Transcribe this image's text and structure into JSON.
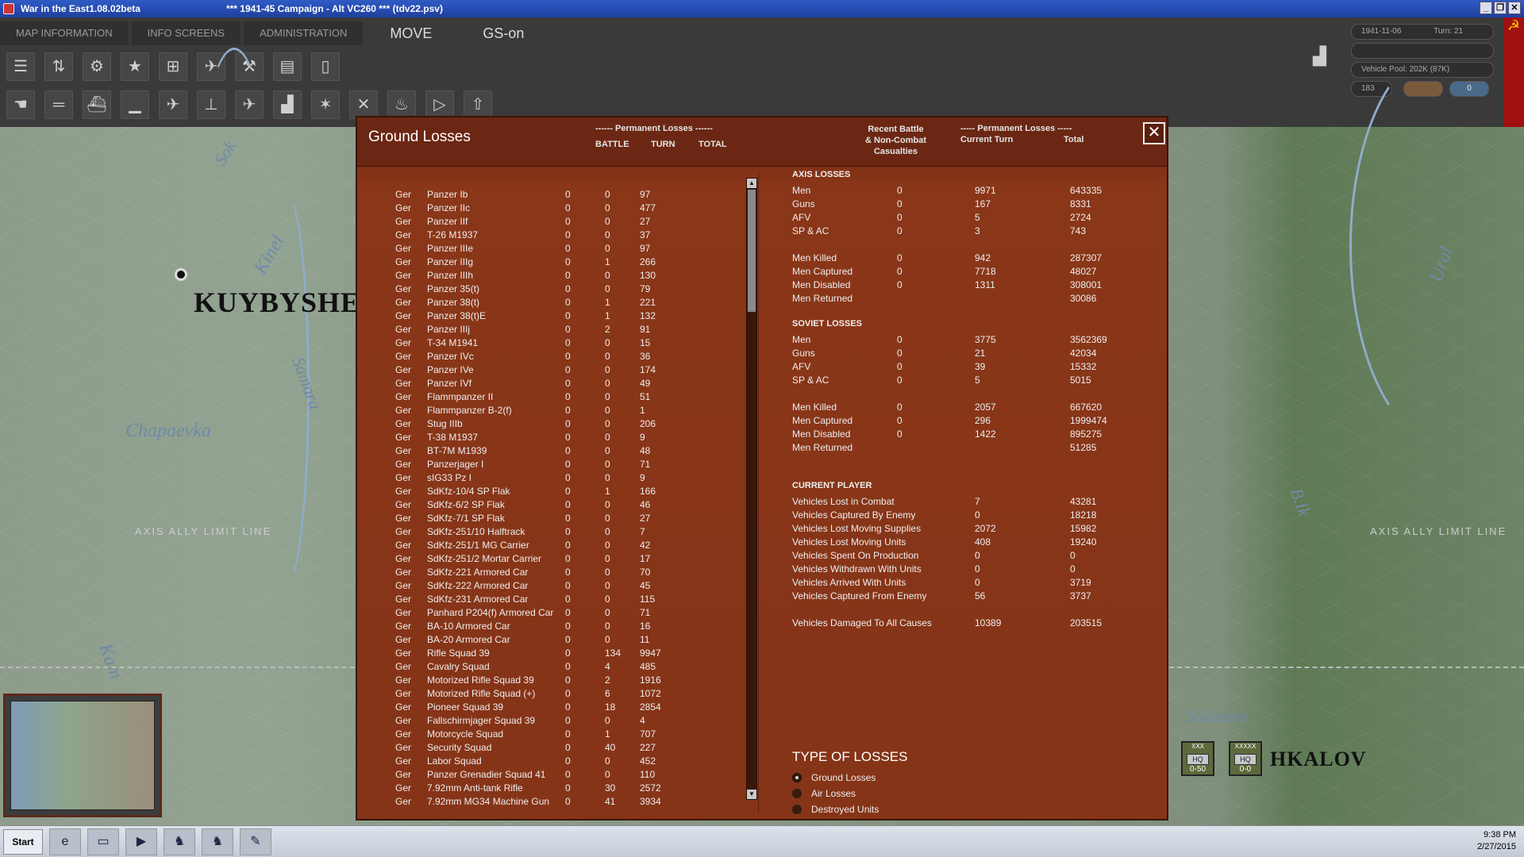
{
  "window": {
    "title": "War in the East1.08.02beta",
    "campaign": "***  1941-45 Campaign - Alt VC260  ***   (tdv22.psv)"
  },
  "menu": {
    "map_info": "MAP INFORMATION",
    "info_screens": "INFO SCREENS",
    "administration": "ADMINISTRATION",
    "mode": "MOVE",
    "gs": "GS-on"
  },
  "status": {
    "date": "1941-11-06",
    "turn": "Turn: 21",
    "vehicle_pool": "Vehicle Pool: 202K (87K)",
    "value": "183"
  },
  "map": {
    "city1": "KUYBYSHEV",
    "city2": "HKALOV",
    "rivers": [
      "Sok",
      "Kinel",
      "Samara",
      "Chapaevka",
      "Kam",
      "Ural",
      "B.Ik",
      "Sakmara"
    ],
    "limit_label": "AXIS ALLY LIMIT LINE",
    "unit1_top": "XXX",
    "unit1_bottom": "0-50",
    "unit2_top": "XXXXX",
    "unit2_bottom": "0-0",
    "hq": "HQ"
  },
  "dialog": {
    "title": "Ground Losses",
    "left_header": {
      "group": "------ Permanent Losses ------",
      "battle": "BATTLE",
      "turn": "TURN",
      "total": "TOTAL"
    },
    "right_header": {
      "recent1": "Recent Battle",
      "recent2": "& Non-Combat",
      "recent3": "Casualties",
      "group": "----- Permanent Losses -----",
      "current": "Current Turn",
      "total": "Total"
    },
    "rows": [
      [
        "Ger",
        "Panzer Ib",
        "0",
        "0",
        "97"
      ],
      [
        "Ger",
        "Panzer IIc",
        "0",
        "0",
        "477"
      ],
      [
        "Ger",
        "Panzer IIf",
        "0",
        "0",
        "27"
      ],
      [
        "Ger",
        "T-26 M1937",
        "0",
        "0",
        "37"
      ],
      [
        "Ger",
        "Panzer IIIe",
        "0",
        "0",
        "97"
      ],
      [
        "Ger",
        "Panzer IIIg",
        "0",
        "1",
        "266"
      ],
      [
        "Ger",
        "Panzer IIIh",
        "0",
        "0",
        "130"
      ],
      [
        "Ger",
        "Panzer 35(t)",
        "0",
        "0",
        "79"
      ],
      [
        "Ger",
        "Panzer 38(t)",
        "0",
        "1",
        "221"
      ],
      [
        "Ger",
        "Panzer 38(t)E",
        "0",
        "1",
        "132"
      ],
      [
        "Ger",
        "Panzer IIIj",
        "0",
        "2",
        "91"
      ],
      [
        "Ger",
        "T-34 M1941",
        "0",
        "0",
        "15"
      ],
      [
        "Ger",
        "Panzer IVc",
        "0",
        "0",
        "36"
      ],
      [
        "Ger",
        "Panzer IVe",
        "0",
        "0",
        "174"
      ],
      [
        "Ger",
        "Panzer IVf",
        "0",
        "0",
        "49"
      ],
      [
        "Ger",
        "Flammpanzer II",
        "0",
        "0",
        "51"
      ],
      [
        "Ger",
        "Flammpanzer B-2(f)",
        "0",
        "0",
        "1"
      ],
      [
        "Ger",
        "Stug IIIb",
        "0",
        "0",
        "206"
      ],
      [
        "Ger",
        "T-38 M1937",
        "0",
        "0",
        "9"
      ],
      [
        "Ger",
        "BT-7M M1939",
        "0",
        "0",
        "48"
      ],
      [
        "Ger",
        "Panzerjager I",
        "0",
        "0",
        "71"
      ],
      [
        "Ger",
        "sIG33 Pz I",
        "0",
        "0",
        "9"
      ],
      [
        "Ger",
        "SdKfz-10/4 SP Flak",
        "0",
        "1",
        "166"
      ],
      [
        "Ger",
        "SdKfz-6/2 SP Flak",
        "0",
        "0",
        "46"
      ],
      [
        "Ger",
        "SdKfz-7/1 SP Flak",
        "0",
        "0",
        "27"
      ],
      [
        "Ger",
        "SdKfz-251/10 Halftrack",
        "0",
        "0",
        "7"
      ],
      [
        "Ger",
        "SdKfz-251/1 MG Carrier",
        "0",
        "0",
        "42"
      ],
      [
        "Ger",
        "SdKfz-251/2 Mortar Carrier",
        "0",
        "0",
        "17"
      ],
      [
        "Ger",
        "SdKfz-221 Armored Car",
        "0",
        "0",
        "70"
      ],
      [
        "Ger",
        "SdKfz-222 Armored Car",
        "0",
        "0",
        "45"
      ],
      [
        "Ger",
        "SdKfz-231 Armored Car",
        "0",
        "0",
        "115"
      ],
      [
        "Ger",
        "Panhard P204(f) Armored Car",
        "0",
        "0",
        "71"
      ],
      [
        "Ger",
        "BA-10 Armored Car",
        "0",
        "0",
        "16"
      ],
      [
        "Ger",
        "BA-20 Armored Car",
        "0",
        "0",
        "11"
      ],
      [
        "Ger",
        "Rifle Squad 39",
        "0",
        "134",
        "9947"
      ],
      [
        "Ger",
        "Cavalry Squad",
        "0",
        "4",
        "485"
      ],
      [
        "Ger",
        "Motorized Rifle Squad 39",
        "0",
        "2",
        "1916"
      ],
      [
        "Ger",
        "Motorized Rifle Squad (+)",
        "0",
        "6",
        "1072"
      ],
      [
        "Ger",
        "Pioneer Squad 39",
        "0",
        "18",
        "2854"
      ],
      [
        "Ger",
        "Fallschirmjager Squad 39",
        "0",
        "0",
        "4"
      ],
      [
        "Ger",
        "Motorcycle Squad",
        "0",
        "1",
        "707"
      ],
      [
        "Ger",
        "Security Squad",
        "0",
        "40",
        "227"
      ],
      [
        "Ger",
        "Labor Squad",
        "0",
        "0",
        "452"
      ],
      [
        "Ger",
        "Panzer Grenadier Squad 41",
        "0",
        "0",
        "110"
      ],
      [
        "Ger",
        "7.92mm Anti-tank Rifle",
        "0",
        "30",
        "2572"
      ],
      [
        "Ger",
        "7.92mm MG34 Machine Gun",
        "0",
        "41",
        "3934"
      ]
    ],
    "axis_title": "AXIS LOSSES",
    "axis": [
      [
        "Men",
        "0",
        "9971",
        "643335"
      ],
      [
        "Guns",
        "0",
        "167",
        "8331"
      ],
      [
        "AFV",
        "0",
        "5",
        "2724"
      ],
      [
        "SP & AC",
        "0",
        "3",
        "743"
      ],
      [
        "",
        "",
        "",
        ""
      ],
      [
        "Men Killed",
        "0",
        "942",
        "287307"
      ],
      [
        "Men Captured",
        "0",
        "7718",
        "48027"
      ],
      [
        "Men Disabled",
        "0",
        "1311",
        "308001"
      ],
      [
        "Men Returned",
        "",
        "",
        "30086"
      ]
    ],
    "soviet_title": "SOVIET LOSSES",
    "soviet": [
      [
        "Men",
        "0",
        "3775",
        "3562369"
      ],
      [
        "Guns",
        "0",
        "21",
        "42034"
      ],
      [
        "AFV",
        "0",
        "39",
        "15332"
      ],
      [
        "SP & AC",
        "0",
        "5",
        "5015"
      ],
      [
        "",
        "",
        "",
        ""
      ],
      [
        "Men Killed",
        "0",
        "2057",
        "667620"
      ],
      [
        "Men Captured",
        "0",
        "296",
        "1999474"
      ],
      [
        "Men Disabled",
        "0",
        "1422",
        "895275"
      ],
      [
        "Men Returned",
        "",
        "",
        "51285"
      ]
    ],
    "player_title": "CURRENT PLAYER",
    "player": [
      [
        "Vehicles Lost in Combat",
        "7",
        "43281"
      ],
      [
        "Vehicles Captured By Enemy",
        "0",
        "18218"
      ],
      [
        "Vehicles Lost Moving Supplies",
        "2072",
        "15982"
      ],
      [
        "Vehicles Lost Moving Units",
        "408",
        "19240"
      ],
      [
        "Vehicles Spent On Production",
        "0",
        "0"
      ],
      [
        "Vehicles Withdrawn With Units",
        "0",
        "0"
      ],
      [
        "Vehicles Arrived With Units",
        "0",
        "3719"
      ],
      [
        "Vehicles Captured From Enemy",
        "56",
        "3737"
      ],
      [
        "",
        "",
        ""
      ],
      [
        "Vehicles Damaged To All Causes",
        "10389",
        "203515"
      ]
    ],
    "type_title": "TYPE OF LOSSES",
    "types": [
      "Ground Losses",
      "Air Losses",
      "Destroyed Units"
    ]
  },
  "taskbar": {
    "start": "Start",
    "time": "9:38 PM",
    "date": "2/27/2015"
  }
}
